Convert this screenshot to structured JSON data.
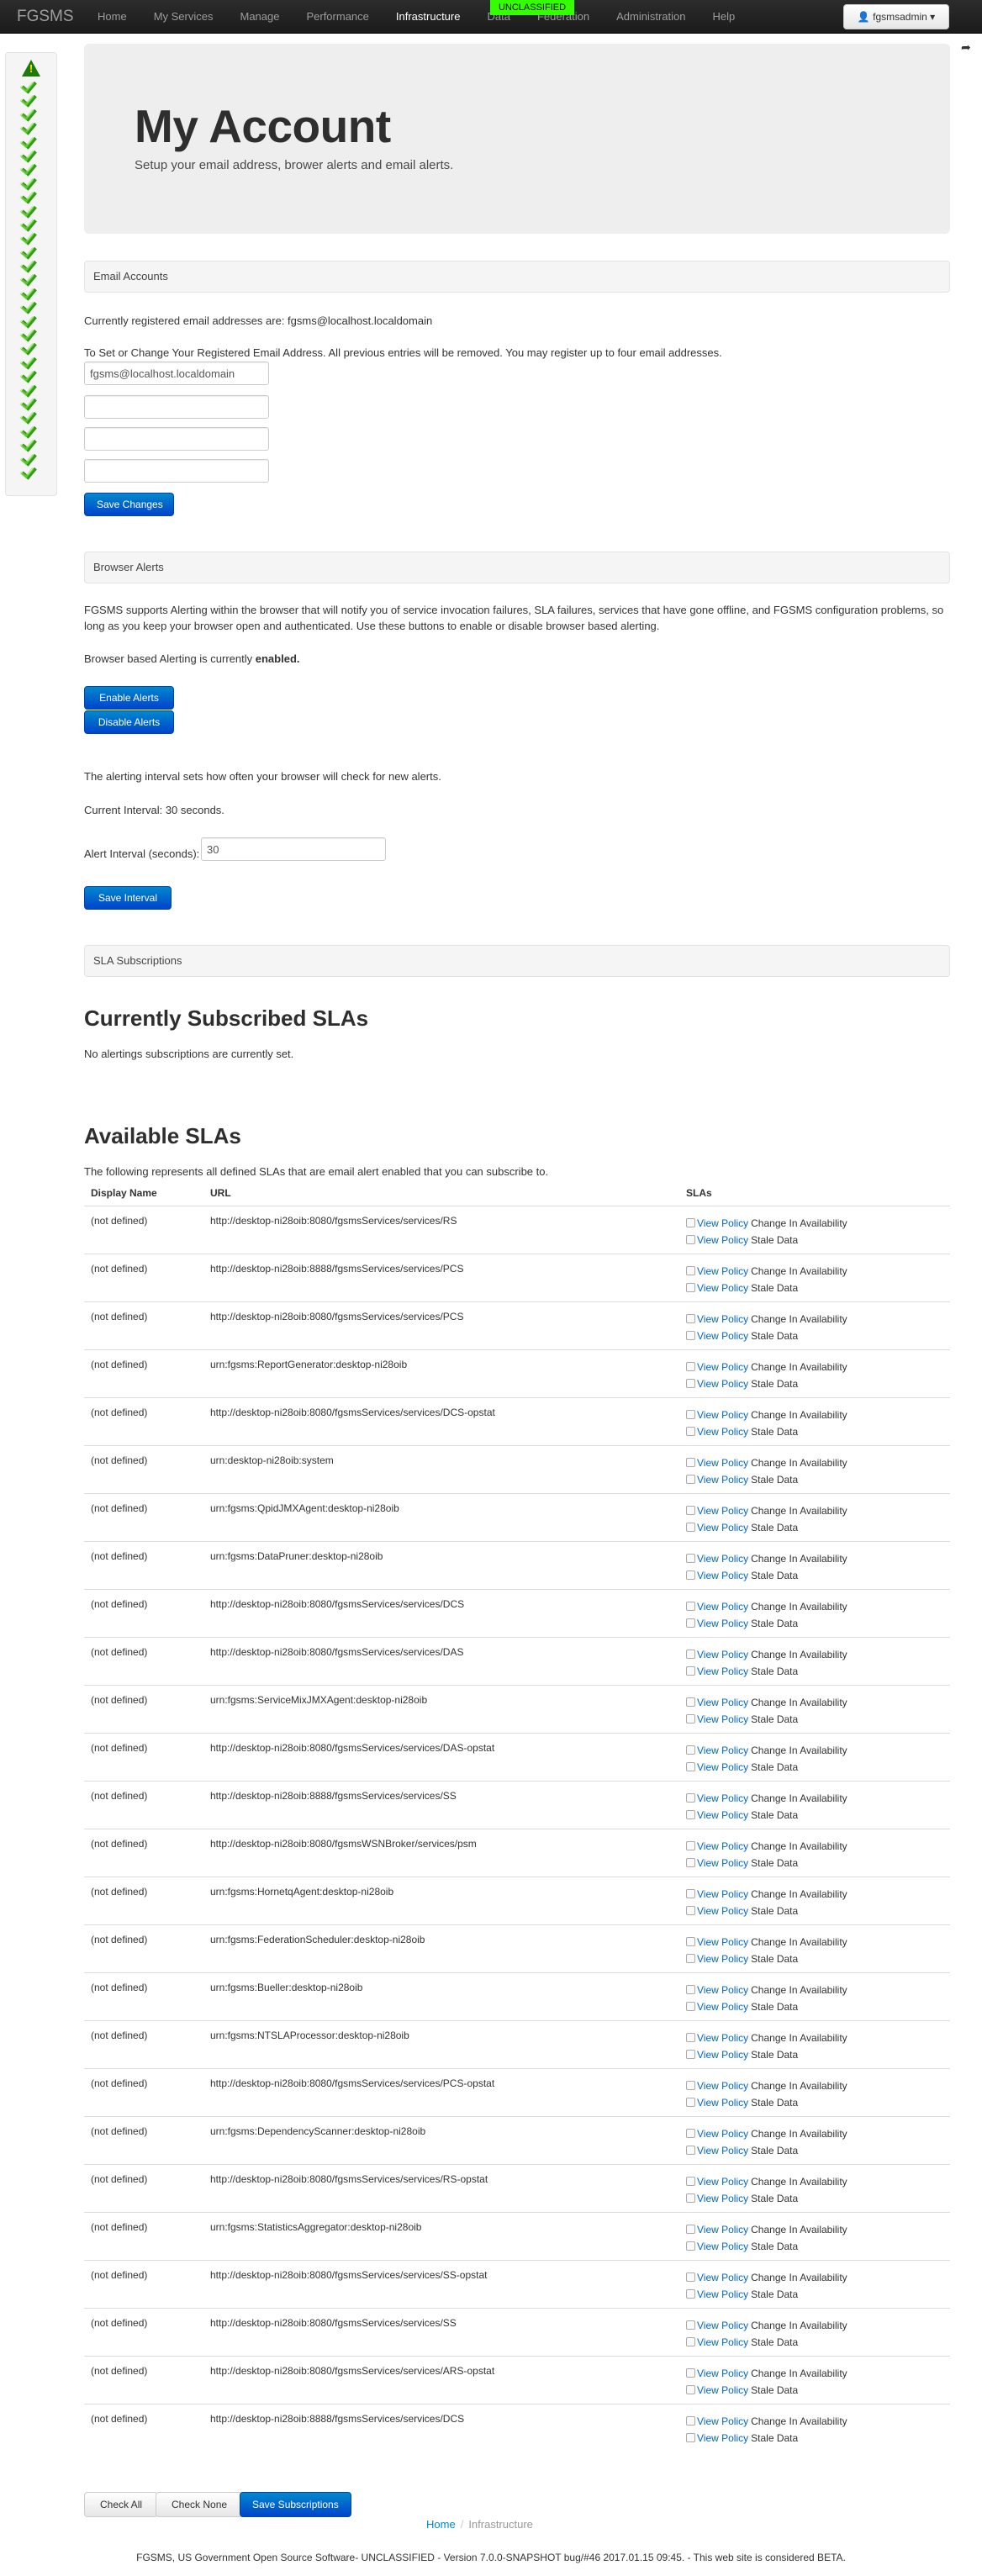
{
  "navbar": {
    "brand": "FGSMS",
    "items": [
      {
        "label": "Home",
        "active": false
      },
      {
        "label": "My Services",
        "active": false
      },
      {
        "label": "Manage",
        "active": false
      },
      {
        "label": "Performance",
        "active": false
      },
      {
        "label": "Infrastructure",
        "active": true
      },
      {
        "label": "Data",
        "active": false
      },
      {
        "label": "Federation",
        "active": false
      },
      {
        "label": "Administration",
        "active": false
      },
      {
        "label": "Help",
        "active": false
      }
    ],
    "classification": "UNCLASSIFIED",
    "user_label": "fgsmsadmin",
    "user_icon": "user-icon",
    "share_icon": "share-icon"
  },
  "status_sidebar": {
    "icons": [
      "warning-icon",
      "check-icon",
      "check-icon",
      "check-icon",
      "check-icon",
      "check-icon",
      "check-icon",
      "check-icon",
      "check-icon",
      "check-icon",
      "check-icon",
      "check-icon",
      "check-icon",
      "check-icon",
      "check-icon",
      "check-icon",
      "check-icon",
      "check-icon",
      "check-icon",
      "check-icon",
      "check-icon",
      "check-icon",
      "check-icon",
      "check-icon",
      "check-icon",
      "check-icon",
      "check-icon",
      "check-icon",
      "check-icon",
      "check-icon"
    ]
  },
  "hero": {
    "title": "My Account",
    "subtitle": "Setup your email address, brower alerts and email alerts."
  },
  "email_section": {
    "header": "Email Accounts",
    "current_text": "Currently registered email addresses are: fgsms@localhost.localdomain",
    "instructions": "To Set or Change Your Registered Email Address. All previous entries will be removed. You may register up to four email addresses.",
    "inputs": [
      "fgsms@localhost.localdomain",
      "",
      "",
      ""
    ],
    "save_label": "Save Changes"
  },
  "browser_alerts": {
    "header": "Browser Alerts",
    "description": "FGSMS supports Alerting within the browser that will notify you of service invocation failures, SLA failures, services that have gone offline, and FGSMS configuration problems, so long as you keep your browser open and authenticated. Use these buttons to enable or disable browser based alerting.",
    "status_prefix": "Browser based Alerting is currently ",
    "status_value": "enabled.",
    "enable_label": "Enable Alerts",
    "disable_label": "Disable Alerts",
    "interval_note": "The alerting interval sets how often your browser will check for new alerts.",
    "current_interval": "Current Interval: 30 seconds.",
    "interval_label": "Alert Interval (seconds):",
    "interval_value": "30",
    "save_interval_label": "Save Interval"
  },
  "sla_subscriptions": {
    "header": "SLA Subscriptions",
    "current_title": "Currently Subscribed SLAs",
    "current_note": "No alertings subscriptions are currently set.",
    "available_title": "Available SLAs",
    "available_note": "The following represents all defined SLAs that are email alert enabled that you can subscribe to.",
    "columns": [
      "Display Name",
      "URL",
      "SLAs"
    ],
    "link_label": "View Policy",
    "rows": [
      {
        "name": "(not defined)",
        "url": "http://desktop-ni28oib:8080/fgsmsServices/services/RS",
        "slas": [
          "Change In Availability",
          "Stale Data"
        ]
      },
      {
        "name": "(not defined)",
        "url": "http://desktop-ni28oib:8888/fgsmsServices/services/PCS",
        "slas": [
          "Change In Availability",
          "Stale Data"
        ]
      },
      {
        "name": "(not defined)",
        "url": "http://desktop-ni28oib:8080/fgsmsServices/services/PCS",
        "slas": [
          "Change In Availability",
          "Stale Data"
        ]
      },
      {
        "name": "(not defined)",
        "url": "urn:fgsms:ReportGenerator:desktop-ni28oib",
        "slas": [
          "Change In Availability",
          "Stale Data"
        ]
      },
      {
        "name": "(not defined)",
        "url": "http://desktop-ni28oib:8080/fgsmsServices/services/DCS-opstat",
        "slas": [
          "Change In Availability",
          "Stale Data"
        ]
      },
      {
        "name": "(not defined)",
        "url": "urn:desktop-ni28oib:system",
        "slas": [
          "Change In Availability",
          "Stale Data"
        ]
      },
      {
        "name": "(not defined)",
        "url": "urn:fgsms:QpidJMXAgent:desktop-ni28oib",
        "slas": [
          "Change In Availability",
          "Stale Data"
        ]
      },
      {
        "name": "(not defined)",
        "url": "urn:fgsms:DataPruner:desktop-ni28oib",
        "slas": [
          "Change In Availability",
          "Stale Data"
        ]
      },
      {
        "name": "(not defined)",
        "url": "http://desktop-ni28oib:8080/fgsmsServices/services/DCS",
        "slas": [
          "Change In Availability",
          "Stale Data"
        ]
      },
      {
        "name": "(not defined)",
        "url": "http://desktop-ni28oib:8080/fgsmsServices/services/DAS",
        "slas": [
          "Change In Availability",
          "Stale Data"
        ]
      },
      {
        "name": "(not defined)",
        "url": "urn:fgsms:ServiceMixJMXAgent:desktop-ni28oib",
        "slas": [
          "Change In Availability",
          "Stale Data"
        ]
      },
      {
        "name": "(not defined)",
        "url": "http://desktop-ni28oib:8080/fgsmsServices/services/DAS-opstat",
        "slas": [
          "Change In Availability",
          "Stale Data"
        ]
      },
      {
        "name": "(not defined)",
        "url": "http://desktop-ni28oib:8888/fgsmsServices/services/SS",
        "slas": [
          "Change In Availability",
          "Stale Data"
        ]
      },
      {
        "name": "(not defined)",
        "url": "http://desktop-ni28oib:8080/fgsmsWSNBroker/services/psm",
        "slas": [
          "Change In Availability",
          "Stale Data"
        ]
      },
      {
        "name": "(not defined)",
        "url": "urn:fgsms:HornetqAgent:desktop-ni28oib",
        "slas": [
          "Change In Availability",
          "Stale Data"
        ]
      },
      {
        "name": "(not defined)",
        "url": "urn:fgsms:FederationScheduler:desktop-ni28oib",
        "slas": [
          "Change In Availability",
          "Stale Data"
        ]
      },
      {
        "name": "(not defined)",
        "url": "urn:fgsms:Bueller:desktop-ni28oib",
        "slas": [
          "Change In Availability",
          "Stale Data"
        ]
      },
      {
        "name": "(not defined)",
        "url": "urn:fgsms:NTSLAProcessor:desktop-ni28oib",
        "slas": [
          "Change In Availability",
          "Stale Data"
        ]
      },
      {
        "name": "(not defined)",
        "url": "http://desktop-ni28oib:8080/fgsmsServices/services/PCS-opstat",
        "slas": [
          "Change In Availability",
          "Stale Data"
        ]
      },
      {
        "name": "(not defined)",
        "url": "urn:fgsms:DependencyScanner:desktop-ni28oib",
        "slas": [
          "Change In Availability",
          "Stale Data"
        ]
      },
      {
        "name": "(not defined)",
        "url": "http://desktop-ni28oib:8080/fgsmsServices/services/RS-opstat",
        "slas": [
          "Change In Availability",
          "Stale Data"
        ]
      },
      {
        "name": "(not defined)",
        "url": "urn:fgsms:StatisticsAggregator:desktop-ni28oib",
        "slas": [
          "Change In Availability",
          "Stale Data"
        ]
      },
      {
        "name": "(not defined)",
        "url": "http://desktop-ni28oib:8080/fgsmsServices/services/SS-opstat",
        "slas": [
          "Change In Availability",
          "Stale Data"
        ]
      },
      {
        "name": "(not defined)",
        "url": "http://desktop-ni28oib:8080/fgsmsServices/services/SS",
        "slas": [
          "Change In Availability",
          "Stale Data"
        ]
      },
      {
        "name": "(not defined)",
        "url": "http://desktop-ni28oib:8080/fgsmsServices/services/ARS-opstat",
        "slas": [
          "Change In Availability",
          "Stale Data"
        ]
      },
      {
        "name": "(not defined)",
        "url": "http://desktop-ni28oib:8888/fgsmsServices/services/DCS",
        "slas": [
          "Change In Availability",
          "Stale Data"
        ]
      }
    ],
    "check_all_label": "Check All",
    "check_none_label": "Check None",
    "save_label": "Save Subscriptions"
  },
  "breadcrumb": {
    "home": "Home",
    "current": "Infrastructure"
  },
  "footer": "FGSMS, US Government Open Source Software- UNCLASSIFIED - Version 7.0.0-SNAPSHOT bug/#46 2017.01.15 09:45. - This web site is considered BETA."
}
